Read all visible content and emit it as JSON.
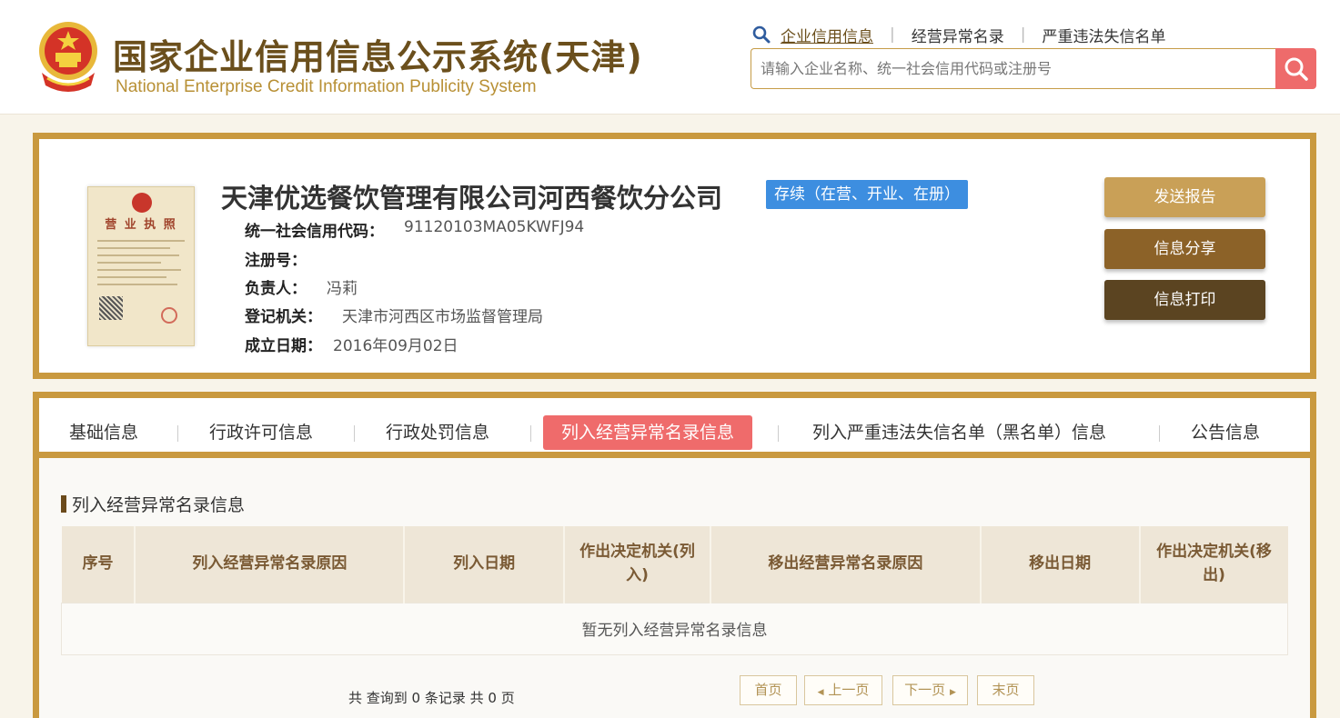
{
  "header": {
    "title_cn": "国家企业信用信息公示系统(天津)",
    "title_en": "National Enterprise Credit Information Publicity System",
    "nav": [
      {
        "label": "企业信用信息",
        "active": true
      },
      {
        "label": "经营异常名录",
        "active": false
      },
      {
        "label": "严重违法失信名单",
        "active": false
      }
    ],
    "search_placeholder": "请输入企业名称、统一社会信用代码或注册号"
  },
  "company": {
    "name": "天津优选餐饮管理有限公司河西餐饮分公司",
    "status": "存续（在营、开业、在册）",
    "license_title": "营 业 执 照",
    "fields": [
      {
        "label": "统一社会信用代码：",
        "value": "91120103MA05KWFJ94"
      },
      {
        "label": "注册号：",
        "value": ""
      },
      {
        "label": "负责人：",
        "value": "冯莉"
      },
      {
        "label": "登记机关：",
        "value": "天津市河西区市场监督管理局"
      },
      {
        "label": "成立日期：",
        "value": "2016年09月02日"
      }
    ],
    "actions": {
      "report": "发送报告",
      "share": "信息分享",
      "print": "信息打印"
    }
  },
  "tabs": [
    {
      "label": "基础信息",
      "active": false
    },
    {
      "label": "行政许可信息",
      "active": false
    },
    {
      "label": "行政处罚信息",
      "active": false
    },
    {
      "label": "列入经营异常名录信息",
      "active": true
    },
    {
      "label": "列入严重违法失信名单（黑名单）信息",
      "active": false
    },
    {
      "label": "公告信息",
      "active": false
    }
  ],
  "section": {
    "title": "列入经营异常名录信息",
    "columns": [
      "序号",
      "列入经营异常名录原因",
      "列入日期",
      "作出决定机关(列入)",
      "移出经营异常名录原因",
      "移出日期",
      "作出决定机关(移出)"
    ],
    "empty_text": "暂无列入经营异常名录信息",
    "pager": {
      "summary": "共 查询到 0 条记录 共 0 页",
      "first": "首页",
      "prev": "上一页",
      "next": "下一页",
      "last": "末页"
    }
  },
  "colors": {
    "gold_border": "#c9993f",
    "active_tab": "#ef6b6b",
    "status_badge": "#3d8ee0",
    "search_button": "#ee6b6b",
    "btn_report": "#c9a057",
    "btn_share": "#8c6228",
    "btn_print": "#5b4421"
  }
}
